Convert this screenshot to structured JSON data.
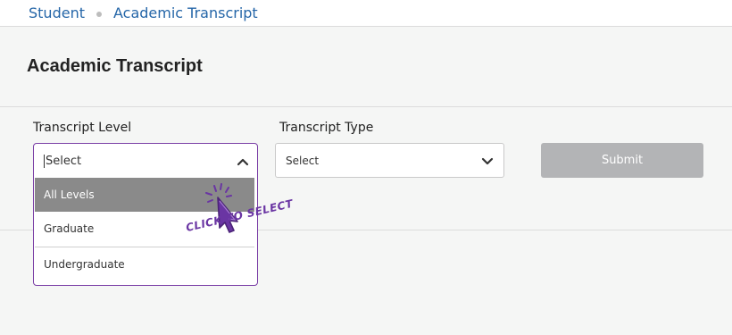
{
  "breadcrumb": {
    "items": [
      "Student",
      "Academic Transcript"
    ]
  },
  "page": {
    "title": "Academic Transcript"
  },
  "form": {
    "transcript_level": {
      "label": "Transcript Level",
      "value": "Select",
      "open": true,
      "options": [
        "All Levels",
        "Graduate",
        "Undergraduate"
      ],
      "highlighted": "All Levels"
    },
    "transcript_type": {
      "label": "Transcript Type",
      "value": "Select"
    },
    "submit_label": "Submit"
  },
  "annotation": {
    "text": "CLICK TO SELECT",
    "icon": "click-pointer-icon"
  },
  "colors": {
    "link": "#2566a8",
    "accent": "#7a3fa6",
    "annotation": "#6a35a3",
    "highlight": "#8a8a8a",
    "button_disabled": "#b3b4b6"
  }
}
